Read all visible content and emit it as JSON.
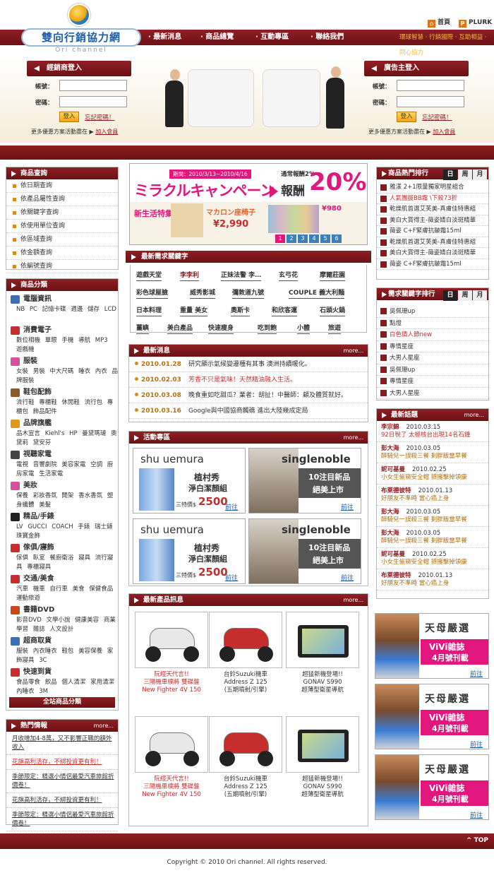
{
  "header": {
    "site_title": "雙向行銷協力網",
    "site_subtitle": "Ori channel",
    "toplinks": [
      {
        "label": "首頁"
      },
      {
        "label": "PLURK"
      }
    ],
    "nav": [
      {
        "label": "最新消息"
      },
      {
        "label": "商品總覽"
      },
      {
        "label": "互動專區"
      },
      {
        "label": "聯絡我們"
      }
    ],
    "slogan": "環球智慧 · 行銷國際 · 互助相益 · 同心協力"
  },
  "login_dealer": {
    "title": "經銷商登入",
    "account_label": "帳號：",
    "password_label": "密碼：",
    "submit": "登入",
    "forgot": "忘記密碼！",
    "more_text": "更多優惠方案活動盡在",
    "join": "加入會員"
  },
  "login_advertiser": {
    "title": "廣告主登入",
    "account_label": "帳號：",
    "password_label": "密碼：",
    "submit": "登入",
    "forgot": "忘記密碼！",
    "more_text": "更多優惠方案活動盡在",
    "join": "加入會員"
  },
  "product_search": {
    "title": "商品查詢",
    "items": [
      {
        "label": "依日期查詢"
      },
      {
        "label": "依產品屬性查詢"
      },
      {
        "label": "依關鍵字查詢"
      },
      {
        "label": "依使用單位查詢"
      },
      {
        "label": "依區域查詢"
      },
      {
        "label": "依金額查詢"
      },
      {
        "label": "依編號查詢"
      }
    ]
  },
  "categories": {
    "title": "商品分類",
    "items": [
      {
        "name": "電腦資訊",
        "sub": "NB PC 記憶卡碟 週邊 儲存 LCD",
        "color": "#3b6fb6"
      },
      {
        "name": "消費電子",
        "sub": "數位相機 單眼 手機 導航 MP3 遊戲機",
        "color": "#c62d2d"
      },
      {
        "name": "服裝",
        "sub": "女裝 男裝 中大尺碼 睡衣 內衣 品牌服裝",
        "color": "#d94f9a"
      },
      {
        "name": "鞋包配飾",
        "sub": "流行鞋 專櫃鞋 休閒鞋 流行包 專櫃包 飾品配件",
        "color": "#8a5a2b"
      },
      {
        "name": "品牌旗艦",
        "sub": "品木宣言 Kiehl's HP 曼黛瑪璉 奧黛莉 黛安芬",
        "color": "#e19a17"
      },
      {
        "name": "視聽家電",
        "sub": "電視 音響劇院 美容家電 空調 廚房家電 生活家電",
        "color": "#444444"
      },
      {
        "name": "美妝",
        "sub": "保養 彩妝香氛 開架 香水香氛 塑身纖體 美髮",
        "color": "#d94f9a"
      },
      {
        "name": "精品/手錶",
        "sub": "LV GUCCI COACH 手錶 瑞士錶 珠寶金飾",
        "color": "#222222"
      },
      {
        "name": "傢俱/寢飾",
        "sub": "傢俱 臥室 餐廚衛浴 寢具 流行寢具 專櫃寢具",
        "color": "#c62d2d"
      },
      {
        "name": "交通/美食",
        "sub": "汽車 機車 自行車 美食 保健食品 運動旅遊",
        "color": "#c62d2d"
      },
      {
        "name": "書籍DVD",
        "sub": "影音DVD 文學小說 健康美容 商業學習 雜誌 人文設計",
        "color": "#c9491a"
      },
      {
        "name": "超商取貨",
        "sub": "服裝 內衣睡衣 鞋包 美容保養 家飾寢具 3C",
        "color": "#3b6fb6"
      },
      {
        "name": "快速到貨",
        "sub": "食品零食 飲品 個人清潔 家用清潔 內睡衣 3M",
        "color": "#c62d2d"
      }
    ],
    "all_label": "全站商品分類"
  },
  "hot_info": {
    "title": "熱門情報",
    "more": "more...",
    "items": [
      {
        "label": "月收增加4-8萬，又不影響正職的額外收入"
      },
      {
        "label": "花旗高利活存，不綁投資更有利！"
      },
      {
        "label": "季節限定：精選小情侶最愛汽車旅館折價卷！"
      },
      {
        "label": "花旗高利活存，不綁投資更有利！"
      },
      {
        "label": "季節限定：精選小情侶最愛汽車旅館折價卷！"
      }
    ]
  },
  "miracle_banner": {
    "dates": "期間：2010/3/13~2010/4/16",
    "title": "ミラクルキャンペーン",
    "reward_label": "通常報酬2%",
    "reward_word": "報酬",
    "percent": "20%",
    "new_life": "新生活特集",
    "macaron": "マカロン座椅子",
    "price": "¥2,990",
    "price2": "¥980",
    "pages": [
      "1",
      "2",
      "3",
      "4",
      "5",
      "6"
    ]
  },
  "keywords": {
    "title": "最新需求關鍵字",
    "items": [
      "遊戲天堂",
      "李李利",
      "正妹法警 李…",
      "玄弓花",
      "摩爾莊園",
      "彩色球屋臉",
      "威秀影城",
      "彌敦道九號",
      "COUPLE 義大利麵",
      "日本料理",
      "重量 美女",
      "奧斯卡",
      "和欣客運",
      "石頭火鍋",
      "薑嶼",
      "美白產品",
      "快速瘦身",
      "吃到飽",
      "小體",
      "旅遊"
    ]
  },
  "news": {
    "title": "最新消息",
    "more": "more...",
    "items": [
      {
        "date": "2010.01.28",
        "text": "研究顯示氣候變遷種有其事 澳洲持續暖化。"
      },
      {
        "date": "2010.02.03",
        "text": "芳香不只是氣味！天然精油融入生活。"
      },
      {
        "date": "2010.03.08",
        "text": "晚食重如吃甜瓜？業者：胡扯！中醫師：顧及體質就好。"
      },
      {
        "date": "2010.03.16",
        "text": "Google與中國協商觸礁 進出大陸幾成定局"
      }
    ]
  },
  "activity": {
    "title": "活動專區",
    "more": "more...",
    "promos": [
      {
        "brand": "shu uemura",
        "line1": "植村秀",
        "line2": "淨白潔顏組",
        "price_label": "三特價$",
        "price": "2500",
        "go": "前往"
      },
      {
        "brand": "singlenoble",
        "line1": "10注目新品",
        "line2": "絕美上市",
        "go": "前往"
      },
      {
        "brand": "shu uemura",
        "line1": "植村秀",
        "line2": "淨白潔顏組",
        "price_label": "三特價$",
        "price": "2500",
        "go": "前往"
      },
      {
        "brand": "singlenoble",
        "line1": "10注目新品",
        "line2": "絕美上市",
        "go": "前往"
      }
    ]
  },
  "new_products": {
    "title": "最新產品訊息",
    "more": "more...",
    "items": [
      {
        "l1": "阮經天代言!!",
        "l2": "三陽機車樸將 雙碟盤",
        "l3": "New Fighter 4V 150",
        "kind": "scooter-white"
      },
      {
        "l1": "台鈴Suzuki機車",
        "l2": "Address Z 125",
        "l3": "(五期噴射/引擎)",
        "kind": "scooter-red"
      },
      {
        "l1": "超猛新機登場!!",
        "l2": "GONAV S990",
        "l3": "超薄型衛星導航",
        "kind": "gps"
      },
      {
        "l1": "阮經天代言!!",
        "l2": "三陽機車樸將 雙碟盤",
        "l3": "New Fighter 4V 150",
        "kind": "scooter-white"
      },
      {
        "l1": "台鈴Suzuki機車",
        "l2": "Address Z 125",
        "l3": "(五期噴射/引擎)",
        "kind": "scooter-red"
      },
      {
        "l1": "超猛新機登場!!",
        "l2": "GONAV S990",
        "l3": "超薄型衛星導航",
        "kind": "gps"
      }
    ]
  },
  "rank_products": {
    "title": "商品熱門排行",
    "tabs": [
      "日",
      "周",
      "月"
    ],
    "items": [
      "雅漾 2+1限量獨家明星組合",
      "人氣團拔BB霜 \\下殺73折",
      "乾燥肌首選艾芙美-真膚佳特惠組",
      "美白大賞得主-薇姿婧白淡斑精華",
      "薇姿 C+F緊膚抗皺霜15ml",
      "乾燥肌首選艾芙美-真膚佳特惠組",
      "美白大賞得主-薇姿婧白淡斑精華",
      "薇姿 C+F緊膚抗皺霜15ml"
    ]
  },
  "rank_keywords": {
    "title": "需求關鍵字排行",
    "tabs": [
      "日",
      "周",
      "月"
    ],
    "items": [
      "吳佩珊up",
      "點燈",
      "白色情人節new",
      "專情星座",
      "大男人星座",
      "吳佩珊up",
      "專情星座",
      "大男人星座"
    ]
  },
  "talk": {
    "title": "最新話題",
    "more": "more...",
    "items": [
      {
        "who": "李宗錦",
        "date": "2010.03.15",
        "topic": "92日稅了 太極核台出現14名石鍾"
      },
      {
        "who": "彭大海",
        "date": "2010.03.05",
        "topic": "醉騎兒一誤殺三餐 剩胖飯當早餐"
      },
      {
        "who": "妮可基曼",
        "date": "2010.02.25",
        "topic": "小女生偷窺安全帽 擠擁擊掉領康"
      },
      {
        "who": "布萊德彼特",
        "date": "2010.01.13",
        "topic": "好朋友不準時 當心癌上身"
      },
      {
        "who": "彭大海",
        "date": "2010.03.05",
        "topic": "醉騎兒一誤殺三餐 剩胖飯當早餐"
      },
      {
        "who": "彭大海",
        "date": "2010.03.05",
        "topic": "醉騎兒一誤殺三餐 剩胖飯當早餐"
      },
      {
        "who": "妮可基曼",
        "date": "2010.02.25",
        "topic": "小女生偷窺安全帽 擠擁擊掉領康"
      },
      {
        "who": "布萊德彼特",
        "date": "2010.01.13",
        "topic": "好朋友不準時 當心癌上身"
      }
    ]
  },
  "vivi_ads": [
    {
      "title": "天母嚴選",
      "mag": "ViVi雜誌",
      "issue": "4月號刊載",
      "go": "前往"
    },
    {
      "title": "天母嚴選",
      "mag": "ViVi雜誌",
      "issue": "4月號刊載",
      "go": "前往"
    },
    {
      "title": "天母嚴選",
      "mag": "ViVi雜誌",
      "issue": "4月號刊載",
      "go": "前往"
    }
  ],
  "footer": {
    "top": "TOP",
    "copyright": "Copyright © 2010 Ori channel. All rights reserved."
  },
  "colors": {
    "brand_dark_red": "#8b1a1f",
    "accent_orange": "#e07417",
    "banner_pink": "#e2177e"
  }
}
